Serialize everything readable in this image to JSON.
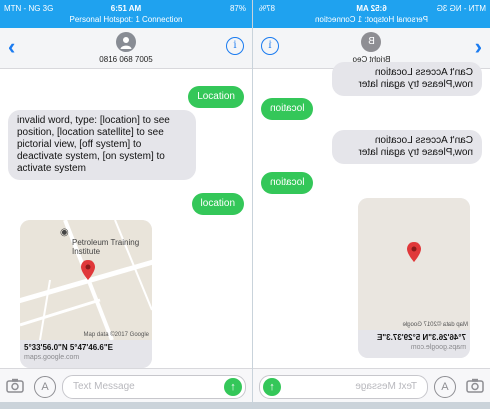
{
  "left": {
    "statusbar": {
      "carrier": "MTN - NG 3G",
      "time": "6:51 AM",
      "battery": "87%",
      "hotspot": "Personal Hotspot: 1 Connection"
    },
    "header": {
      "back": "‹",
      "contact": "0816 068 7005",
      "info": "i"
    },
    "messages": {
      "m1": "Location",
      "m2": "invalid word, type: [location] to see position, [location satellite] to see pictorial view, [off system] to deactivate system, [on system] to activate system",
      "m3": "location"
    },
    "map": {
      "poi": "Petroleum Training Institute",
      "copyright": "Map data ©2017 Google",
      "coords": "5°33'56.0\"N 5°47'46.6\"E",
      "url": "maps.google.com"
    },
    "input": {
      "placeholder": "Text Message"
    }
  },
  "right": {
    "statusbar": {
      "carrier": "MTN - NG 3G",
      "time": "6:52 AM",
      "battery": "87%",
      "hotspot": "Personal Hotspot: 1 Connection"
    },
    "header": {
      "back": "‹",
      "avatar_letter": "B",
      "contact": "Bright Ceo",
      "info": "i"
    },
    "messages": {
      "m1": "Can't Access Location now,Please try again later",
      "m2": "location",
      "m3": "Can't Access Location now,Please try again later",
      "m4": "location"
    },
    "map": {
      "copyright": "Map data ©2017 Google",
      "coords": "7°46'26.3\"N 5°29'37.3\"E",
      "url": "maps.google.com"
    },
    "input": {
      "placeholder": "Text Message"
    }
  },
  "colors": {
    "status_blue": "#1fa2ef",
    "imessage_green": "#34c759",
    "ios_blue": "#1a7bf0",
    "incoming_gray": "#e5e5ea",
    "pin_red": "#e0383a"
  }
}
